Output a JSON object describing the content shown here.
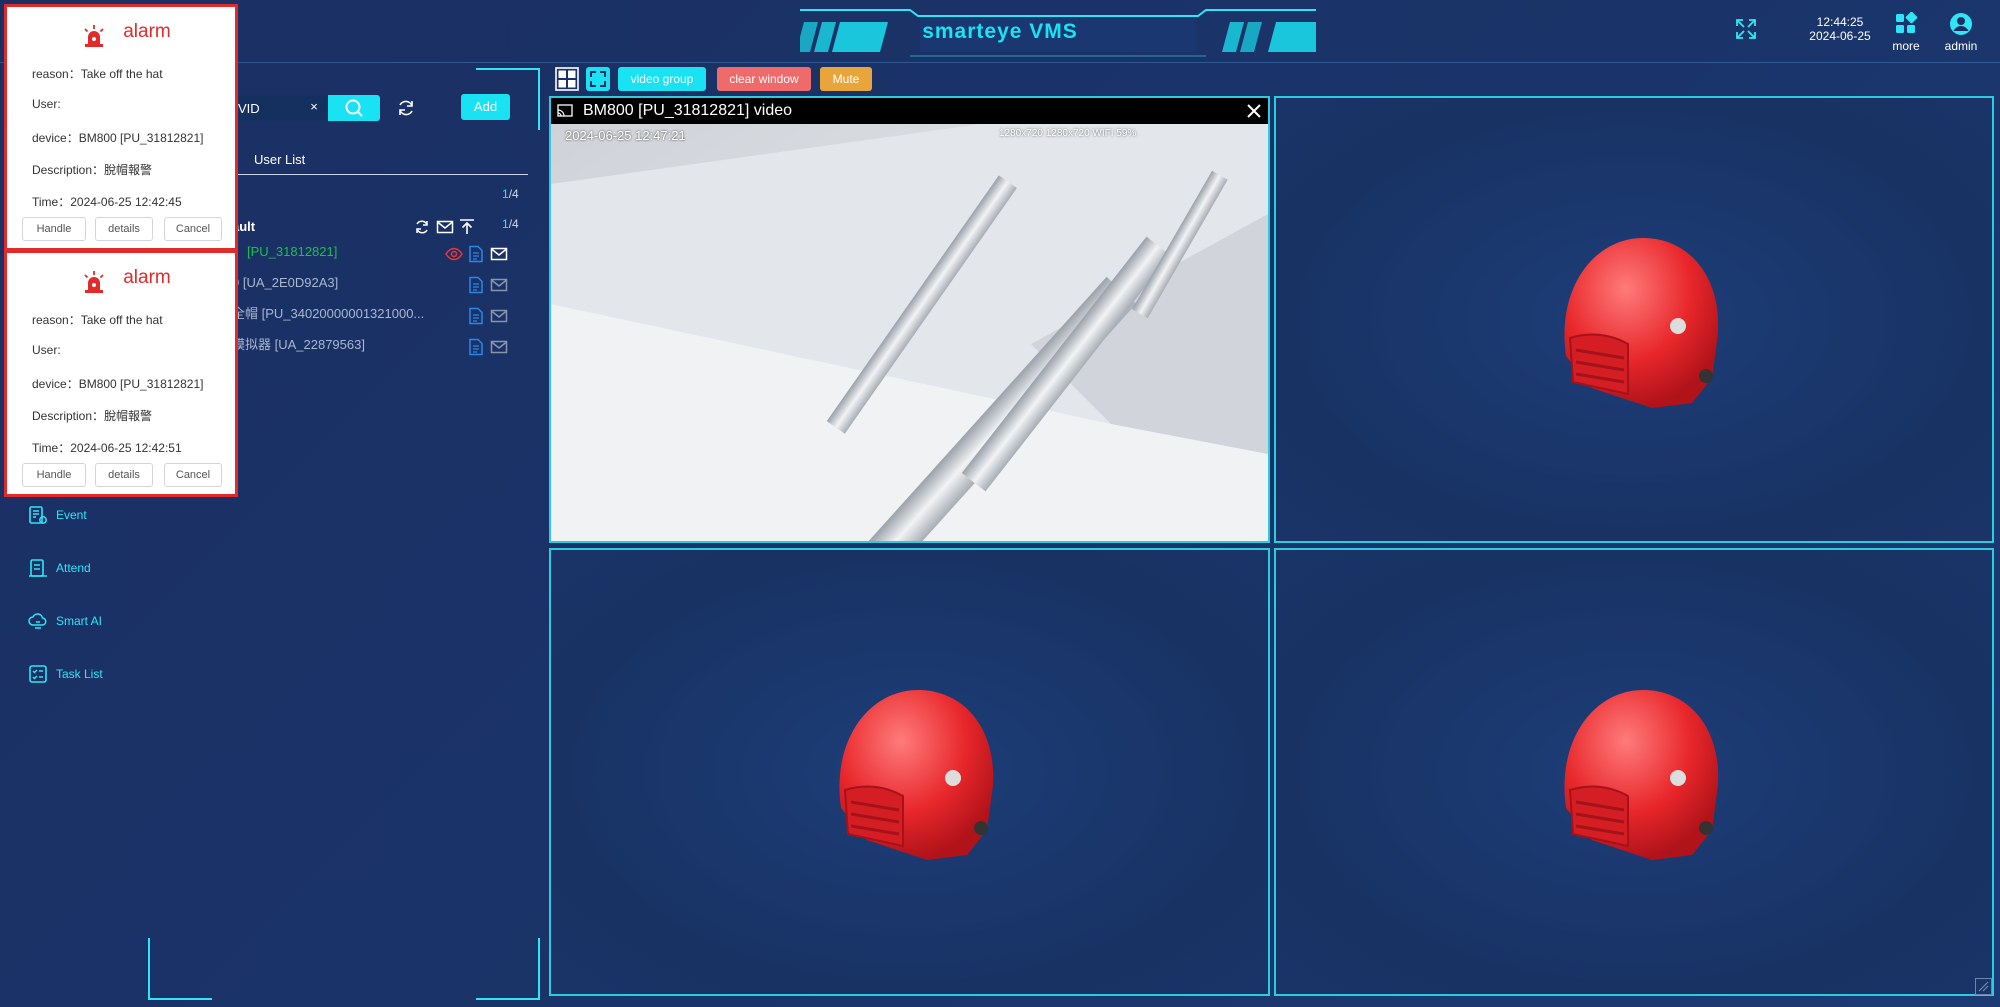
{
  "header": {
    "app_title": "smarteye VMS",
    "time": "12:44:25",
    "date": "2024-06-25",
    "more_label": "more",
    "user_label": "admin",
    "accent_color": "#19e3f3"
  },
  "nav": {
    "items": [
      {
        "label": "Event",
        "icon": "event-icon"
      },
      {
        "label": "Attend",
        "icon": "attend-icon"
      },
      {
        "label": "Smart AI",
        "icon": "smart-ai-icon"
      },
      {
        "label": "Task List",
        "icon": "task-list-icon"
      }
    ]
  },
  "device_panel": {
    "search_value": "VID",
    "clear_symbol": "×",
    "add_label": "Add",
    "tab_label": "User List",
    "count_top": {
      "hi": "1",
      "rest": "/4"
    },
    "count_group": {
      "hi": "1",
      "rest": "/4"
    },
    "group_name": "ault",
    "devices": [
      {
        "name": "[PU_31812821]",
        "color": "#17c24a"
      },
      {
        "name": "0 [UA_2E0D92A3]",
        "color": "#a9b7cf"
      },
      {
        "name": "全帽 [PU_34020000001321000...",
        "color": "#a9b7cf"
      },
      {
        "name": "模拟器 [UA_22879563]",
        "color": "#a9b7cf"
      }
    ]
  },
  "toolbar": {
    "video_group_label": "video group",
    "clear_window_label": "clear window",
    "mute_label": "Mute",
    "colors": {
      "video_group": "#19e3f3",
      "clear_window": "#ef6a6a",
      "mute": "#e8a63a"
    }
  },
  "video": {
    "title": "BM800 [PU_31812821] video",
    "timestamp": "2024-06-25 12:47:21",
    "status": "1280x720  1280x720  WIFI  59%"
  },
  "alarms": [
    {
      "title": "alarm",
      "reason": "reason：Take off the hat",
      "user": "User:",
      "device": "device：BM800 [PU_31812821]",
      "description": "Description：脫帽報警",
      "time": "Time：2024-06-25 12:42:45",
      "buttons": {
        "handle": "Handle",
        "details": "details",
        "cancel": "Cancel"
      }
    },
    {
      "title": "alarm",
      "reason": "reason：Take off the hat",
      "user": "User:",
      "device": "device：BM800 [PU_31812821]",
      "description": "Description：脫帽報警",
      "time": "Time：2024-06-25 12:42:51",
      "buttons": {
        "handle": "Handle",
        "details": "details",
        "cancel": "Cancel"
      }
    }
  ]
}
